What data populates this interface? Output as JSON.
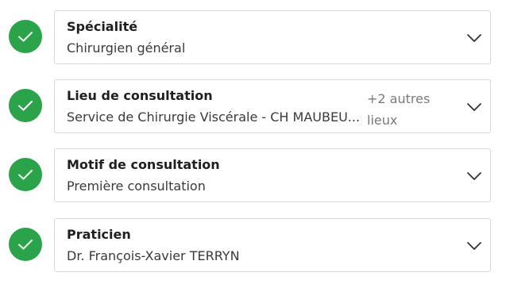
{
  "steps": [
    {
      "title": "Spécialité",
      "value": "Chirurgien général"
    },
    {
      "title": "Lieu de consultation",
      "value": "Service de Chirurgie Viscérale - CH MAUBEU...",
      "extra_line1": "+2 autres",
      "extra_line2": "lieux"
    },
    {
      "title": "Motif de consultation",
      "value": "Première consultation"
    },
    {
      "title": "Praticien",
      "value": "Dr. François-Xavier TERRYN"
    }
  ],
  "colors": {
    "check_green": "#2aa34a",
    "card_border": "#d8d8d8",
    "muted_text": "#7a7a7a"
  },
  "icons": {
    "done": "checkmark-icon",
    "expand": "chevron-down-icon"
  }
}
